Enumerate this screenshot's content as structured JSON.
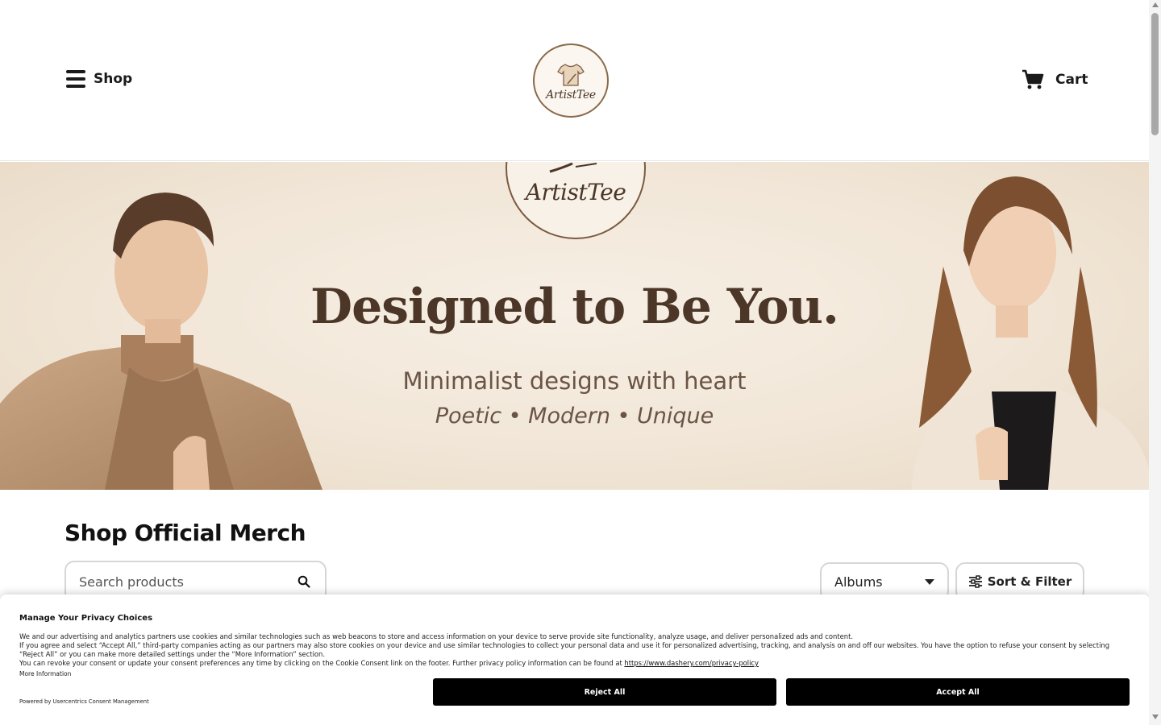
{
  "header": {
    "shop_label": "Shop",
    "cart_label": "Cart",
    "logo_text": "ArtistTee"
  },
  "hero": {
    "logo_text": "ArtistTee",
    "title": "Designed to Be You.",
    "subtitle": "Minimalist designs with heart",
    "tagline": "Poetic • Modern • Unique"
  },
  "shop": {
    "title": "Shop Official Merch",
    "search_placeholder": "Search products",
    "filter_selected": "Albums",
    "sort_label": "Sort & Filter"
  },
  "consent": {
    "title": "Manage Your Privacy Choices",
    "line1": "We and our advertising and analytics partners use cookies and similar technologies such as web beacons to store and access information on your device to serve provide site functionality, analyze usage, and deliver personalized ads and content.",
    "line2": "If you agree and select “Accept All,” third-party companies acting as our partners may also store cookies on your device and use similar technologies to collect your personal data and use it for personalized advertising, tracking, and analysis on and off our websites. You have the option to refuse your consent by selecting “Reject All” or you can make more detailed settings under the “More Information” section.",
    "line3": "You can revoke your consent or update your consent preferences any time by clicking on the Cookie Consent link on the footer. Further privacy policy information can be found at",
    "policy_link": "https://www.dashery.com/privacy-policy",
    "more_info": "More Information",
    "powered_by": "Powered by Usercentrics Consent Management",
    "reject_label": "Reject All",
    "accept_label": "Accept All"
  },
  "colors": {
    "brand_brown": "#4b3628",
    "button_black": "#000000"
  },
  "icons": {
    "menu": "hamburger-icon",
    "cart": "cart-icon",
    "search": "search-icon",
    "sort": "sliders-icon",
    "dropdown": "chevron-down-icon"
  }
}
